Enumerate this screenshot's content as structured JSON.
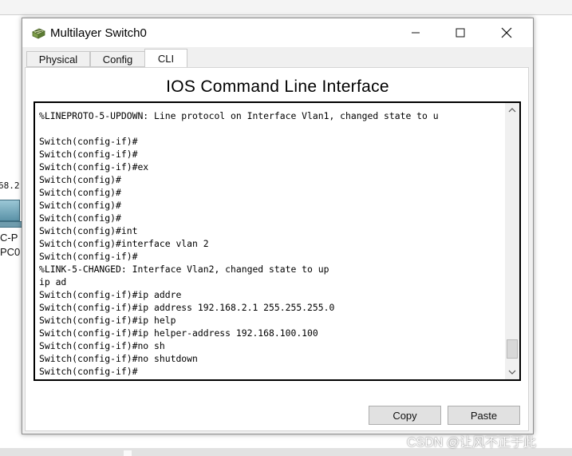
{
  "background": {
    "ip_fragment": "68.2",
    "pc_label_1": "C-P",
    "pc_label_2": "PC0"
  },
  "window": {
    "title": "Multilayer Switch0",
    "icons": {
      "app": "multilayer-switch-icon",
      "minimize": "minimize-icon",
      "maximize": "maximize-icon",
      "close": "close-icon"
    }
  },
  "tabs": [
    {
      "label": "Physical",
      "active": false
    },
    {
      "label": "Config",
      "active": false
    },
    {
      "label": "CLI",
      "active": true
    }
  ],
  "panel": {
    "title": "IOS Command Line Interface"
  },
  "console": {
    "lines": [
      "%LINEPROTO-5-UPDOWN: Line protocol on Interface Vlan1, changed state to u",
      "",
      "Switch(config-if)#",
      "Switch(config-if)#",
      "Switch(config-if)#ex",
      "Switch(config)#",
      "Switch(config)#",
      "Switch(config)#",
      "Switch(config)#",
      "Switch(config)#int",
      "Switch(config)#interface vlan 2",
      "Switch(config-if)#",
      "%LINK-5-CHANGED: Interface Vlan2, changed state to up",
      "ip ad",
      "Switch(config-if)#ip addre",
      "Switch(config-if)#ip address 192.168.2.1 255.255.255.0",
      "Switch(config-if)#ip help",
      "Switch(config-if)#ip helper-address 192.168.100.100",
      "Switch(config-if)#no sh",
      "Switch(config-if)#no shutdown",
      "Switch(config-if)#"
    ]
  },
  "buttons": {
    "copy": "Copy",
    "paste": "Paste"
  },
  "watermark": "CSDN @让风不正于此",
  "colors": {
    "window_bg": "#ffffff",
    "body_bg": "#f0f0f0",
    "button_bg": "#e1e1e1",
    "console_border": "#000000"
  }
}
